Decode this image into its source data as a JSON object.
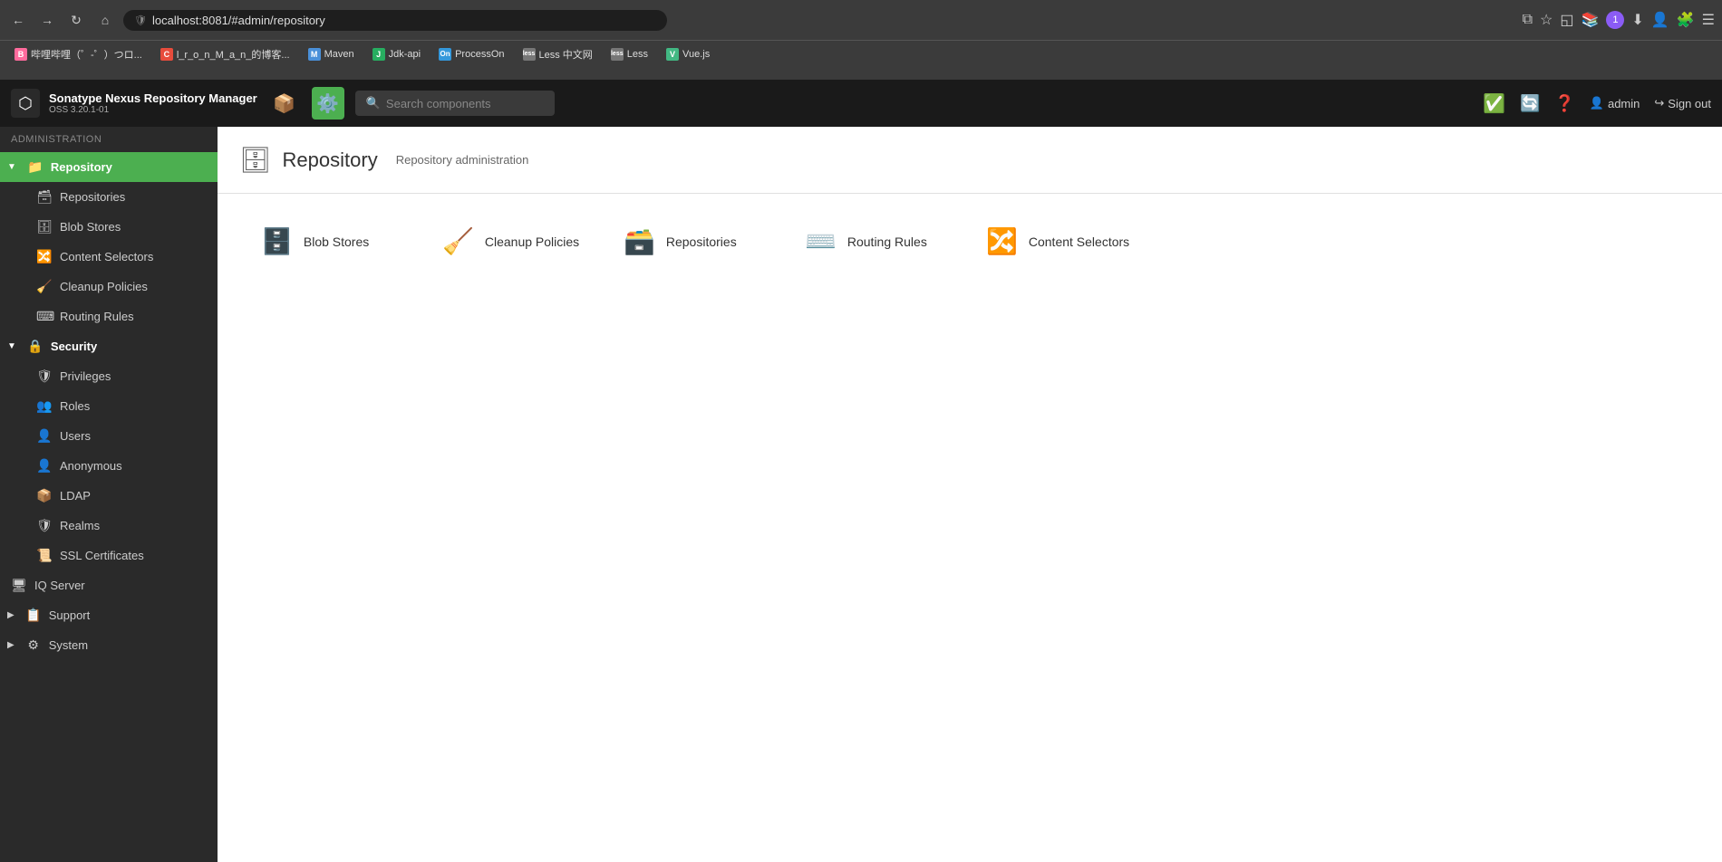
{
  "browser": {
    "address": "localhost:8081/#admin/repository",
    "bookmarks": [
      {
        "label": "哔哩哔哩（゜-゜）つロ...",
        "color": "#ff6b9d",
        "icon": "B"
      },
      {
        "label": "l_r_o_n_M_a_n_的博客...",
        "color": "#e74c3c",
        "icon": "C"
      },
      {
        "label": "Maven",
        "color": "#4a90d9",
        "icon": "M"
      },
      {
        "label": "Jdk-api",
        "color": "#27ae60",
        "icon": "J"
      },
      {
        "label": "ProcessOn",
        "color": "#3498db",
        "icon": "On"
      },
      {
        "label": "Less 中文网",
        "color": "#888",
        "icon": "less"
      },
      {
        "label": "Less",
        "color": "#888",
        "icon": "less"
      },
      {
        "label": "Vue.js",
        "color": "#42b883",
        "icon": "V"
      }
    ]
  },
  "app": {
    "title": "Sonatype Nexus Repository Manager",
    "version": "OSS 3.20.1-01",
    "search_placeholder": "Search components"
  },
  "header": {
    "admin_label": "admin",
    "signout_label": "Sign out"
  },
  "sidebar": {
    "admin_section": "Administration",
    "items": [
      {
        "id": "repository",
        "label": "Repository",
        "type": "parent",
        "active": true,
        "expanded": true
      },
      {
        "id": "repositories",
        "label": "Repositories",
        "type": "child"
      },
      {
        "id": "blob-stores",
        "label": "Blob Stores",
        "type": "child"
      },
      {
        "id": "content-selectors",
        "label": "Content Selectors",
        "type": "child"
      },
      {
        "id": "cleanup-policies",
        "label": "Cleanup Policies",
        "type": "child"
      },
      {
        "id": "routing-rules",
        "label": "Routing Rules",
        "type": "child"
      },
      {
        "id": "security",
        "label": "Security",
        "type": "parent",
        "expanded": true
      },
      {
        "id": "privileges",
        "label": "Privileges",
        "type": "child"
      },
      {
        "id": "roles",
        "label": "Roles",
        "type": "child"
      },
      {
        "id": "users",
        "label": "Users",
        "type": "child"
      },
      {
        "id": "anonymous",
        "label": "Anonymous",
        "type": "child"
      },
      {
        "id": "ldap",
        "label": "LDAP",
        "type": "child"
      },
      {
        "id": "realms",
        "label": "Realms",
        "type": "child"
      },
      {
        "id": "ssl-certificates",
        "label": "SSL Certificates",
        "type": "child"
      },
      {
        "id": "iq-server",
        "label": "IQ Server",
        "type": "root"
      },
      {
        "id": "support",
        "label": "Support",
        "type": "root"
      },
      {
        "id": "system",
        "label": "System",
        "type": "root"
      }
    ]
  },
  "page": {
    "title": "Repository",
    "subtitle": "Repository administration",
    "cards": [
      {
        "id": "blob-stores",
        "label": "Blob Stores",
        "icon": "🗄️"
      },
      {
        "id": "cleanup-policies",
        "label": "Cleanup Policies",
        "icon": "🧹"
      },
      {
        "id": "repositories",
        "label": "Repositories",
        "icon": "🗃️"
      },
      {
        "id": "routing-rules",
        "label": "Routing Rules",
        "icon": "⌨️"
      },
      {
        "id": "content-selectors",
        "label": "Content Selectors",
        "icon": "🔀"
      }
    ]
  }
}
